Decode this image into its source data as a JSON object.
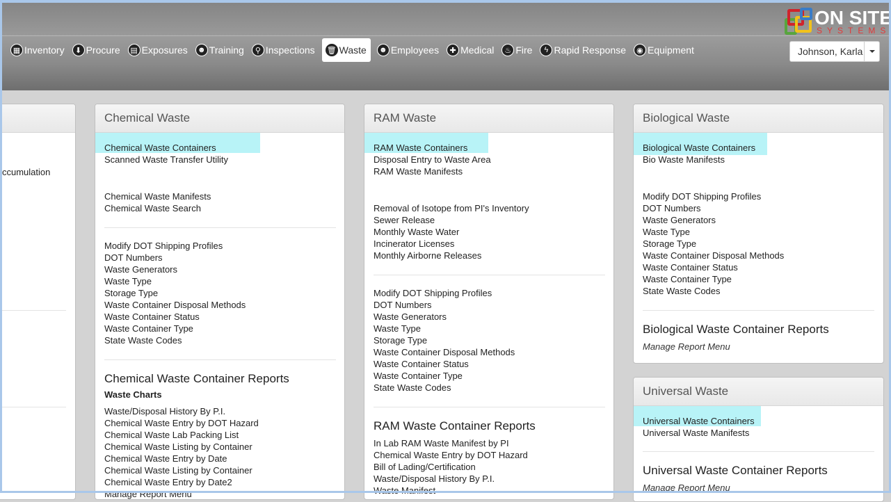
{
  "logo": {
    "word": "ON SITE",
    "sub": "SYSTEMS"
  },
  "nav": [
    {
      "label": "Inventory",
      "icon": "inventory-icon",
      "glyph": "▦"
    },
    {
      "label": "Procure",
      "icon": "download-icon",
      "glyph": "⬇"
    },
    {
      "label": "Exposures",
      "icon": "clipboard-icon",
      "glyph": "▤"
    },
    {
      "label": "Training",
      "icon": "people-icon",
      "glyph": "☻"
    },
    {
      "label": "Inspections",
      "icon": "search-icon",
      "glyph": "⚲"
    },
    {
      "label": "Waste",
      "icon": "trash-icon",
      "glyph": "🗑"
    },
    {
      "label": "Employees",
      "icon": "group-icon",
      "glyph": "☻"
    },
    {
      "label": "Medical",
      "icon": "plus-icon",
      "glyph": "✚"
    },
    {
      "label": "Fire",
      "icon": "fire-icon",
      "glyph": "♨"
    },
    {
      "label": "Rapid Response",
      "icon": "bolt-icon",
      "glyph": "ϟ"
    },
    {
      "label": "Equipment",
      "icon": "gauge-icon",
      "glyph": "◉"
    }
  ],
  "active_nav": "Waste",
  "user": {
    "name": "Johnson, Karla"
  },
  "partial_left": {
    "text": "ccumulation"
  },
  "chemical": {
    "title": "Chemical Waste",
    "group1": [
      "Chemical Waste Containers",
      "Scanned Waste Transfer Utility"
    ],
    "group2": [
      "Chemical Waste Manifests",
      "Chemical Waste Search"
    ],
    "group3": [
      "Modify DOT Shipping Profiles",
      "DOT Numbers",
      "Waste Generators",
      "Waste Type",
      "Storage Type",
      "Waste Container Disposal Methods",
      "Waste Container Status",
      "Waste Container Type",
      "State Waste Codes"
    ],
    "reports_title": "Chemical Waste Container Reports",
    "charts_title": "Waste Charts",
    "reports": [
      "Waste/Disposal History By P.I.",
      "Chemical Waste Entry by DOT Hazard",
      "Chemical Waste Lab Packing List",
      "Chemical Waste Listing by Container",
      "Chemical Waste Entry by Date",
      "Chemical Waste Listing by Container",
      "Chemical Waste Entry by Date2",
      "Manage Report Menu"
    ]
  },
  "ram": {
    "title": "RAM Waste",
    "group1": [
      "RAM Waste Containers",
      "Disposal Entry to Waste Area",
      "RAM Waste Manifests"
    ],
    "group2": [
      "Removal of Isotope from PI's Inventory",
      "Sewer Release",
      "Monthly Waste Water",
      "Incinerator Licenses",
      "Monthly Airborne Releases"
    ],
    "group3": [
      "Modify DOT Shipping Profiles",
      "DOT Numbers",
      "Waste Generators",
      "Waste Type",
      "Storage Type",
      "Waste Container Disposal Methods",
      "Waste Container Status",
      "Waste Container Type",
      "State Waste Codes"
    ],
    "reports_title": "RAM Waste Container Reports",
    "reports": [
      "In Lab RAM Waste Manifest by PI",
      "Chemical Waste Entry by DOT Hazard",
      "Bill of Lading/Certification",
      "Waste/Disposal History By P.I.",
      "Waste Manifest"
    ]
  },
  "bio": {
    "title": "Biological Waste",
    "group1": [
      "Biological Waste Containers",
      "Bio Waste Manifests"
    ],
    "group2": [
      "Modify DOT Shipping Profiles",
      "DOT Numbers",
      "Waste Generators",
      "Waste Type",
      "Storage Type",
      "Waste Container Disposal Methods",
      "Waste Container Status",
      "Waste Container Type",
      "State Waste Codes"
    ],
    "reports_title": "Biological Waste Container Reports",
    "manage": "Manage Report Menu"
  },
  "universal": {
    "title": "Universal Waste",
    "group1": [
      "Universal Waste Containers",
      "Universal Waste Manifests"
    ],
    "reports_title": "Universal Waste Container Reports",
    "manage": "Manage Report Menu"
  },
  "colors": {
    "highlight": "#b8f3f7",
    "header": "#8a8a8a",
    "frame": "#a9c7ea"
  }
}
